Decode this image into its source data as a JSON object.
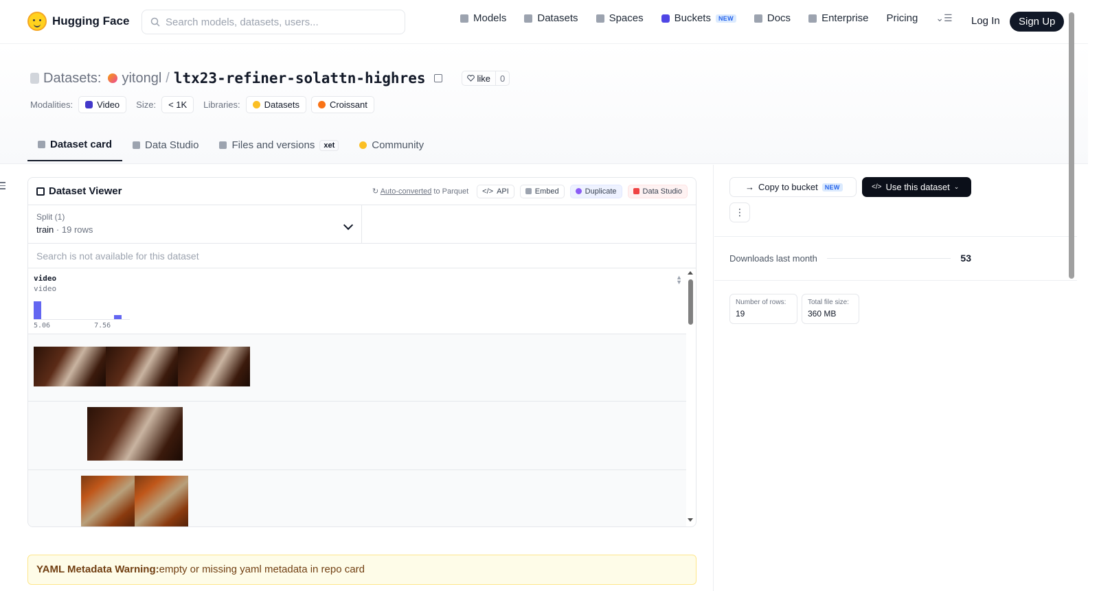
{
  "nav": {
    "brand": "Hugging Face",
    "search_placeholder": "Search models, datasets, users...",
    "links": [
      "Models",
      "Datasets",
      "Spaces",
      "Buckets",
      "Docs",
      "Enterprise",
      "Pricing"
    ],
    "new_badge": "NEW",
    "login": "Log In",
    "signup": "Sign Up"
  },
  "header": {
    "section": "Datasets:",
    "owner": "yitongl",
    "slash": "/",
    "repo": "ltx23-refiner-solattn-highres",
    "like_label": "like",
    "like_count": "0",
    "modalities_label": "Modalities:",
    "modality": "Video",
    "size_label": "Size:",
    "size": "< 1K",
    "libraries_label": "Libraries:",
    "libraries": [
      "Datasets",
      "Croissant"
    ]
  },
  "tabs": [
    "Dataset card",
    "Data Studio",
    "Files and versions",
    "Community"
  ],
  "xet_badge": "xet",
  "viewer": {
    "title": "Dataset Viewer",
    "autoconv_link": "Auto-converted",
    "autoconv_suffix": " to Parquet",
    "buttons": [
      "API",
      "Embed",
      "Duplicate",
      "Data Studio"
    ],
    "split_label": "Split (1)",
    "split_name": "train",
    "split_dot": "·",
    "split_rows": "19 rows",
    "search_na": "Search is not available for this dataset",
    "column_name": "video",
    "column_type": "video",
    "hist_min": "5.06",
    "hist_max": "7.56"
  },
  "warning": {
    "title": "YAML Metadata Warning:",
    "text": "empty or missing yaml metadata in repo card"
  },
  "sidebar": {
    "copy_bucket": "Copy to bucket",
    "use_dataset": "Use this dataset",
    "more": "⋮",
    "downloads_label": "Downloads last month",
    "downloads": "53",
    "rows_label": "Number of rows:",
    "rows": "19",
    "filesize_label": "Total file size:",
    "filesize": "360 MB"
  }
}
